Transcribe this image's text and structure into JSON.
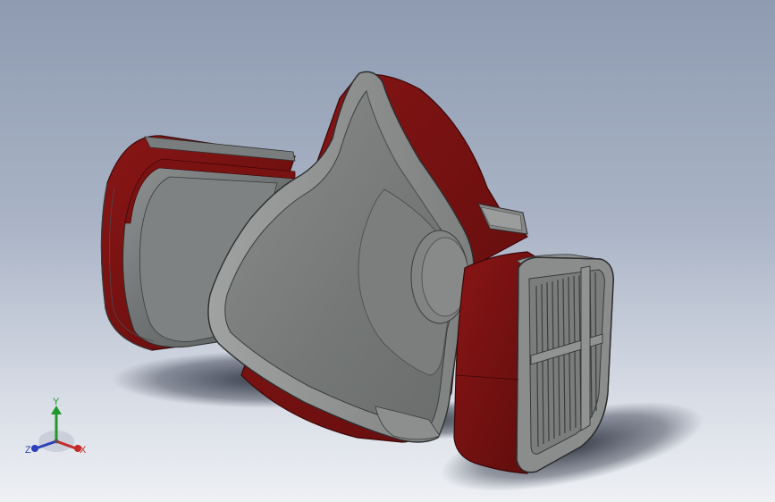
{
  "viewport": {
    "background_top": "#8e9bb1",
    "background_bottom": "#eef0f4"
  },
  "model": {
    "icon": "respirator-half-mask-model",
    "body_color": "#6d7070",
    "accent_color": "#7a1212",
    "filter_color": "#8a8d8d"
  },
  "triad": {
    "y_label": "Y",
    "x_label": "X",
    "z_label": "Z",
    "y_color": "#1f9a2a",
    "x_color": "#c42a2a",
    "z_color": "#2a3fb8"
  }
}
